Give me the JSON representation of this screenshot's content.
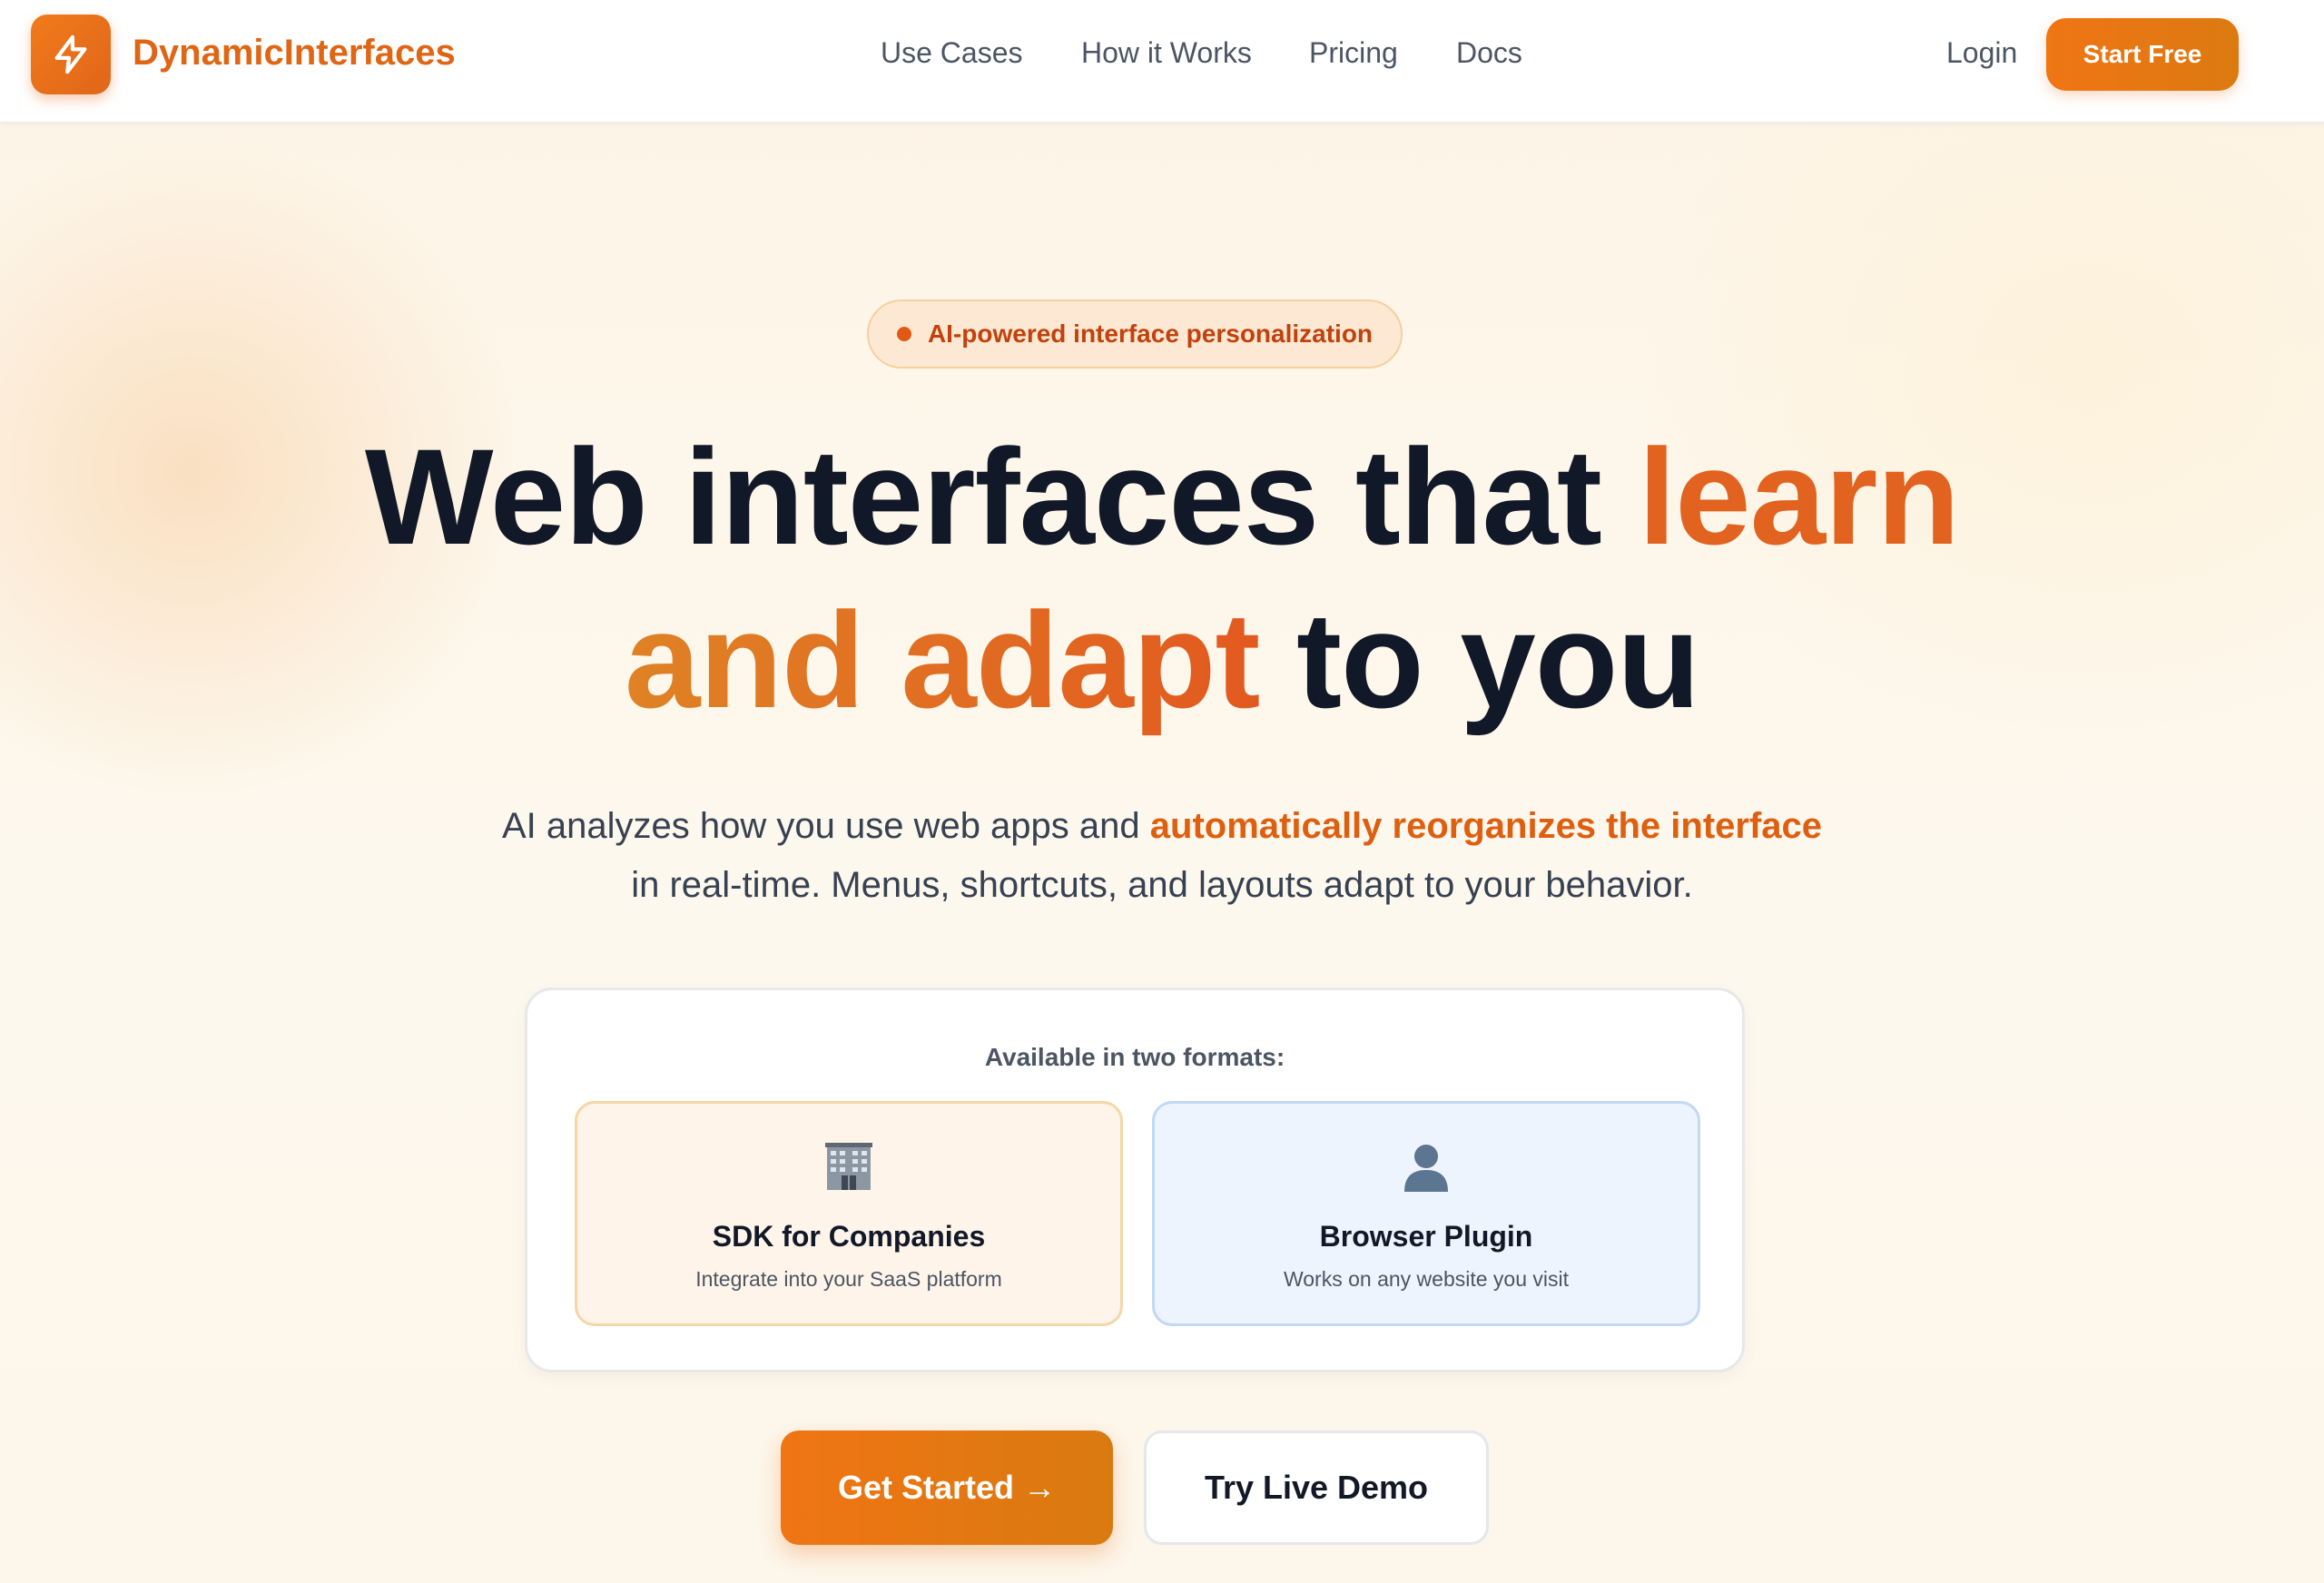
{
  "brand": {
    "name": "DynamicInterfaces",
    "logo_icon": "lightning-bolt-icon",
    "accent_color": "#e2621f",
    "accent_color_dark": "#c2410c"
  },
  "nav": {
    "links": [
      "Use Cases",
      "How it Works",
      "Pricing",
      "Docs"
    ],
    "login_label": "Login",
    "cta_label": "Start Free"
  },
  "hero": {
    "badge": "AI-powered interface personalization",
    "headline": {
      "line1_prefix": "Web interfaces that ",
      "line1_accent": "learn",
      "line2_accent": "and adapt",
      "line2_suffix": " to you"
    },
    "subtitle": {
      "part1": "AI analyzes how you use web apps and ",
      "highlight": "automatically reorganizes the interface",
      "line2": "in real-time. Menus, shortcuts, and layouts adapt to your behavior."
    }
  },
  "formats": {
    "title": "Available in two formats:",
    "items": [
      {
        "icon": "office-building-icon",
        "title": "SDK for Companies",
        "description": "Integrate into your SaaS platform"
      },
      {
        "icon": "user-silhouette-icon",
        "title": "Browser Plugin",
        "description": "Works on any website you visit"
      }
    ]
  },
  "cta": {
    "primary_label": "Get Started →",
    "secondary_label": "Try Live Demo"
  }
}
